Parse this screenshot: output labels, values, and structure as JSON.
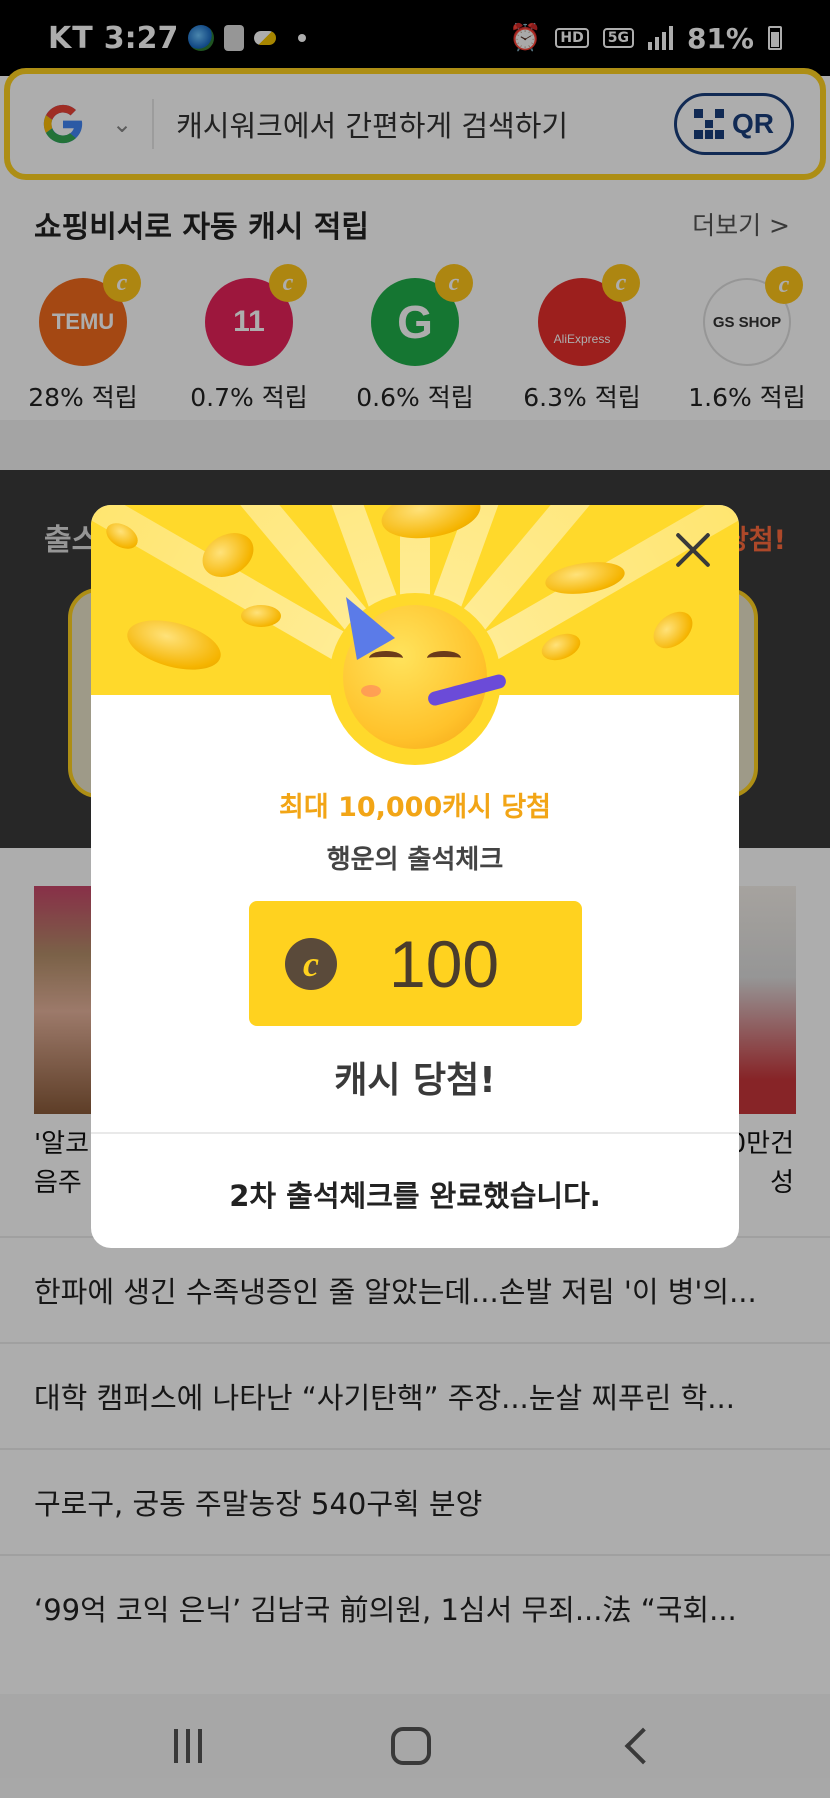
{
  "status_bar": {
    "carrier": "KT",
    "time": "3:27",
    "network_badge_hd": "HD",
    "network_badge_5g": "5G",
    "battery": "81%"
  },
  "search": {
    "placeholder": "캐시워크에서 간편하게 검색하기",
    "qr_label": "QR"
  },
  "shopping": {
    "title": "쇼핑비서로 자동 캐시 적립",
    "more_label": "더보기 >",
    "items": [
      {
        "logo_text": "TEMU",
        "rate": "28% 적립",
        "color": "#f26b1d"
      },
      {
        "logo_text": "11",
        "rate": "0.7% 적립",
        "color": "#e8225a"
      },
      {
        "logo_text": "G",
        "rate": "0.6% 적립",
        "color": "#1fae4a"
      },
      {
        "logo_text": "AliExpress",
        "rate": "6.3% 적립",
        "color": "#e62e2b"
      },
      {
        "logo_text": "GS SHOP",
        "rate": "1.6% 적립",
        "color": "#ffffff"
      }
    ],
    "badge_glyph": "c"
  },
  "attendance_banner": {
    "left_text": "출스",
    "right_text": "당첨!"
  },
  "news": {
    "card_left_caption": [
      "'알코",
      "음주"
    ],
    "card_right_caption": [
      "0만건",
      "성"
    ],
    "items": [
      "한파에 생긴 수족냉증인 줄 알았는데...손발 저림 '이 병'의...",
      "대학 캠퍼스에 나타난 “사기탄핵” 주장...눈살 찌푸린 학...",
      "구로구, 궁동 주말농장 540구획 분양",
      "‘99억 코익 은닉’ 김남국 前의원, 1심서 무죄...法 “국회..."
    ]
  },
  "modal": {
    "promo": "최대 10,000캐시 당첨",
    "subtitle": "행운의 출석체크",
    "prize_amount": "100",
    "prize_coin_glyph": "c",
    "result": "캐시 당첨!",
    "footer": "2차 출석체크를 완료했습니다.",
    "accent_color": "#ffd21f"
  },
  "icons": {
    "close": "close-icon",
    "party_emoji": "party-face-icon",
    "nav_recent": "recent-apps-icon",
    "nav_home": "home-icon",
    "nav_back": "back-icon"
  }
}
